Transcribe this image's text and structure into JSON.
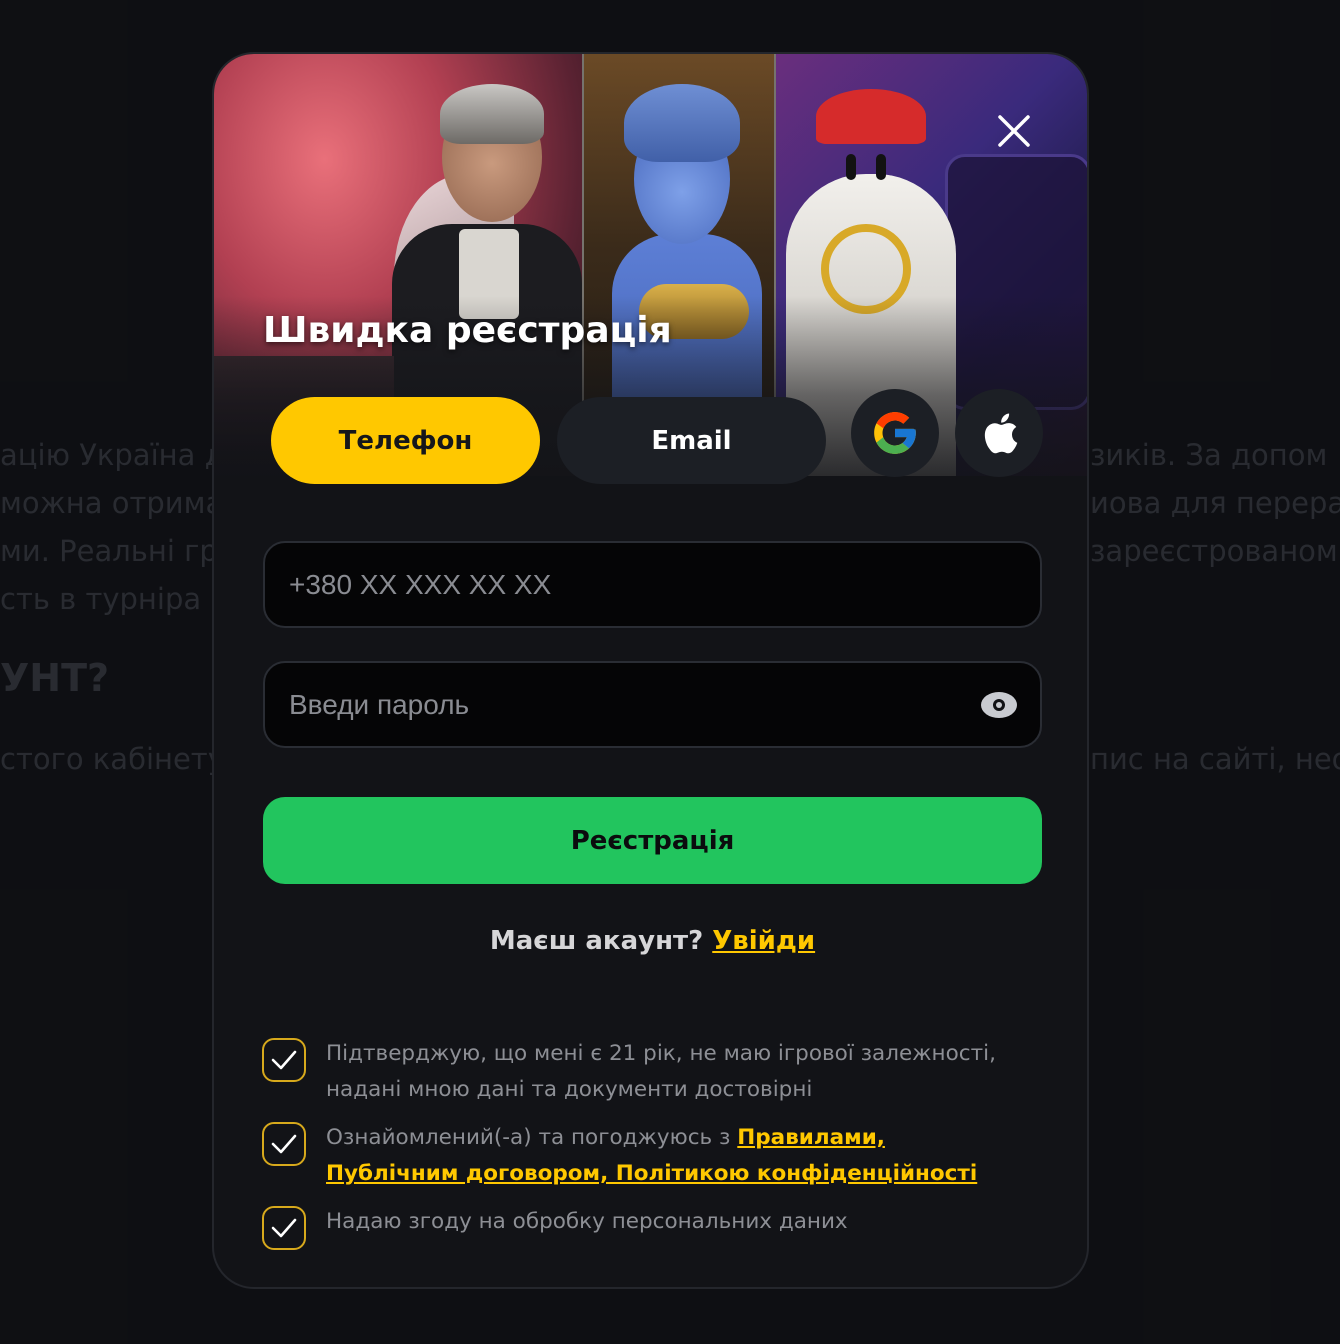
{
  "background_text": {
    "line1_left": "ацію Україна д",
    "line1_right": "зиків. За допом",
    "line2_left": "можна отрима",
    "line2_right": "иова для перера",
    "line3_left": "ми. Реальні гр",
    "line3_right": "зареєстрованом",
    "line4_left": "сть в турніра",
    "heading_left": "УНТ?",
    "line5_left": "стого кабінету",
    "line5_right": "пис на сайті, нео"
  },
  "modal": {
    "title": "Швидка реєстрація",
    "close_icon": "close-icon",
    "tabs": [
      {
        "label": "Телефон",
        "active": true
      },
      {
        "label": "Email",
        "active": false
      }
    ],
    "social": [
      {
        "icon": "google-icon"
      },
      {
        "icon": "apple-icon"
      }
    ],
    "phone_placeholder": "+380 XX XXX XX XX",
    "password_placeholder": "Введи пароль",
    "password_toggle_icon": "eye-icon",
    "register_label": "Реєстрація",
    "have_account_text": "Маєш акаунт?",
    "login_link": "Увійди",
    "consents": [
      {
        "checked": true,
        "text": "Підтверджую, що мені є 21 рік, не маю ігрової залежності, надані мною дані та документи достовірні"
      },
      {
        "checked": true,
        "text_before": "Ознайомлений(-а) та погоджуюсь з ",
        "link_text": "Правилами, Публічним договором, Політикою конфіденційності"
      },
      {
        "checked": true,
        "text": "Надаю згоду на обробку персональних даних"
      }
    ]
  },
  "colors": {
    "accent_yellow": "#ffc800",
    "register_green": "#22c55e",
    "page_bg": "#111216",
    "modal_bg": "#121317"
  }
}
